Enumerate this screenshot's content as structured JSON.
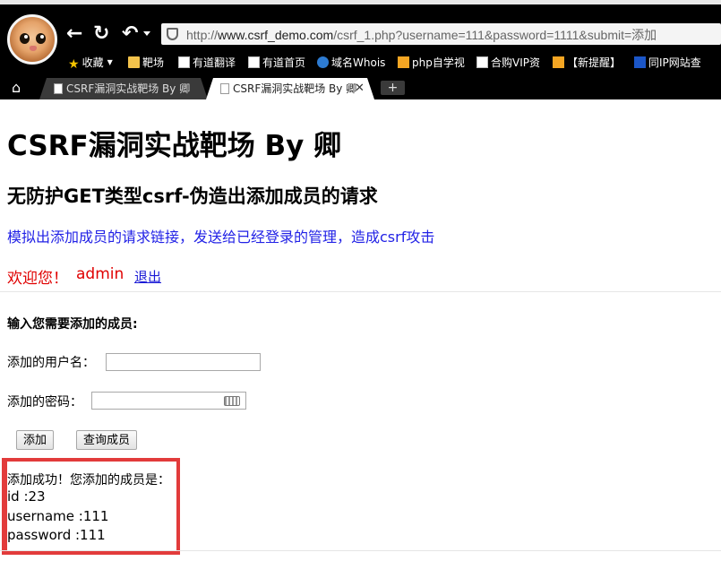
{
  "browser": {
    "url_prefix": "http://",
    "url_domain": "www.csrf_demo.com",
    "url_path": "/csrf_1.php?username=111&password=1111&submit=添加",
    "bookmarks": [
      {
        "label": "收藏",
        "icon": "star-icon"
      },
      {
        "label": "靶场",
        "icon": "folder-icon"
      },
      {
        "label": "有道翻译",
        "icon": "page-icon"
      },
      {
        "label": "有道首页",
        "icon": "page-icon"
      },
      {
        "label": "域名Whois",
        "icon": "globe-icon"
      },
      {
        "label": "php自学视",
        "icon": "bookmark-icon"
      },
      {
        "label": "合购VIP资",
        "icon": "page-icon"
      },
      {
        "label": "【新提醒】",
        "icon": "bookmark-icon"
      },
      {
        "label": "同IP网站查",
        "icon": "bookmark-icon"
      }
    ],
    "tabs": [
      {
        "title": "CSRF漏洞实战靶场 By 卿",
        "active": false
      },
      {
        "title": "CSRF漏洞实战靶场 By 卿",
        "active": true
      }
    ],
    "tab_close": "✕",
    "new_tab": "+"
  },
  "page": {
    "title": "CSRF漏洞实战靶场 By 卿",
    "subtitle": "无防护GET类型csrf-伪造出添加成员的请求",
    "description": "模拟出添加成员的请求链接，发送给已经登录的管理，造成csrf攻击",
    "welcome": "欢迎您！",
    "username": "admin",
    "logout": "退出"
  },
  "form": {
    "title": "输入您需要添加的成员:",
    "username_label": "添加的用户名：",
    "username_value": "",
    "password_label": "添加的密码：",
    "password_value": "",
    "add_button": "添加",
    "query_button": "查询成员"
  },
  "result": {
    "message": "添加成功！您添加的成员是：",
    "id_line": "id :23",
    "username_line": "username :111",
    "password_line": "password :111"
  },
  "colors": {
    "description": "#2222e6",
    "welcome": "#e00000",
    "highlight_box": "#e23b3b"
  }
}
